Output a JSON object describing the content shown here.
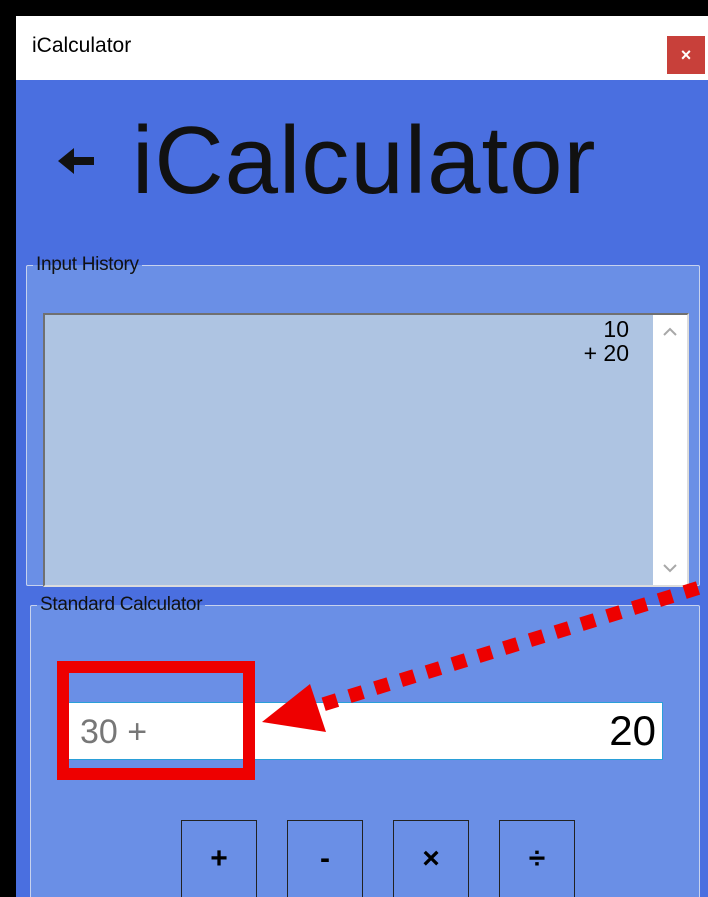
{
  "window": {
    "title": "iCalculator",
    "close_label": "×"
  },
  "header": {
    "back_icon": "back-arrow-icon",
    "title": "iCalculator"
  },
  "history": {
    "legend": "Input History",
    "lines": [
      "10",
      "+ 20"
    ]
  },
  "calculator": {
    "legend": "Standard Calculator",
    "expression": "30 +",
    "current_value": "20",
    "operators": [
      "+",
      "-",
      "×",
      "÷"
    ]
  },
  "colors": {
    "window_bg": "#4a6fe0",
    "group_bg": "#6a8fe6",
    "history_bg": "#aec4e2",
    "annotation": "#ee0000",
    "close_button": "#c8403a"
  }
}
